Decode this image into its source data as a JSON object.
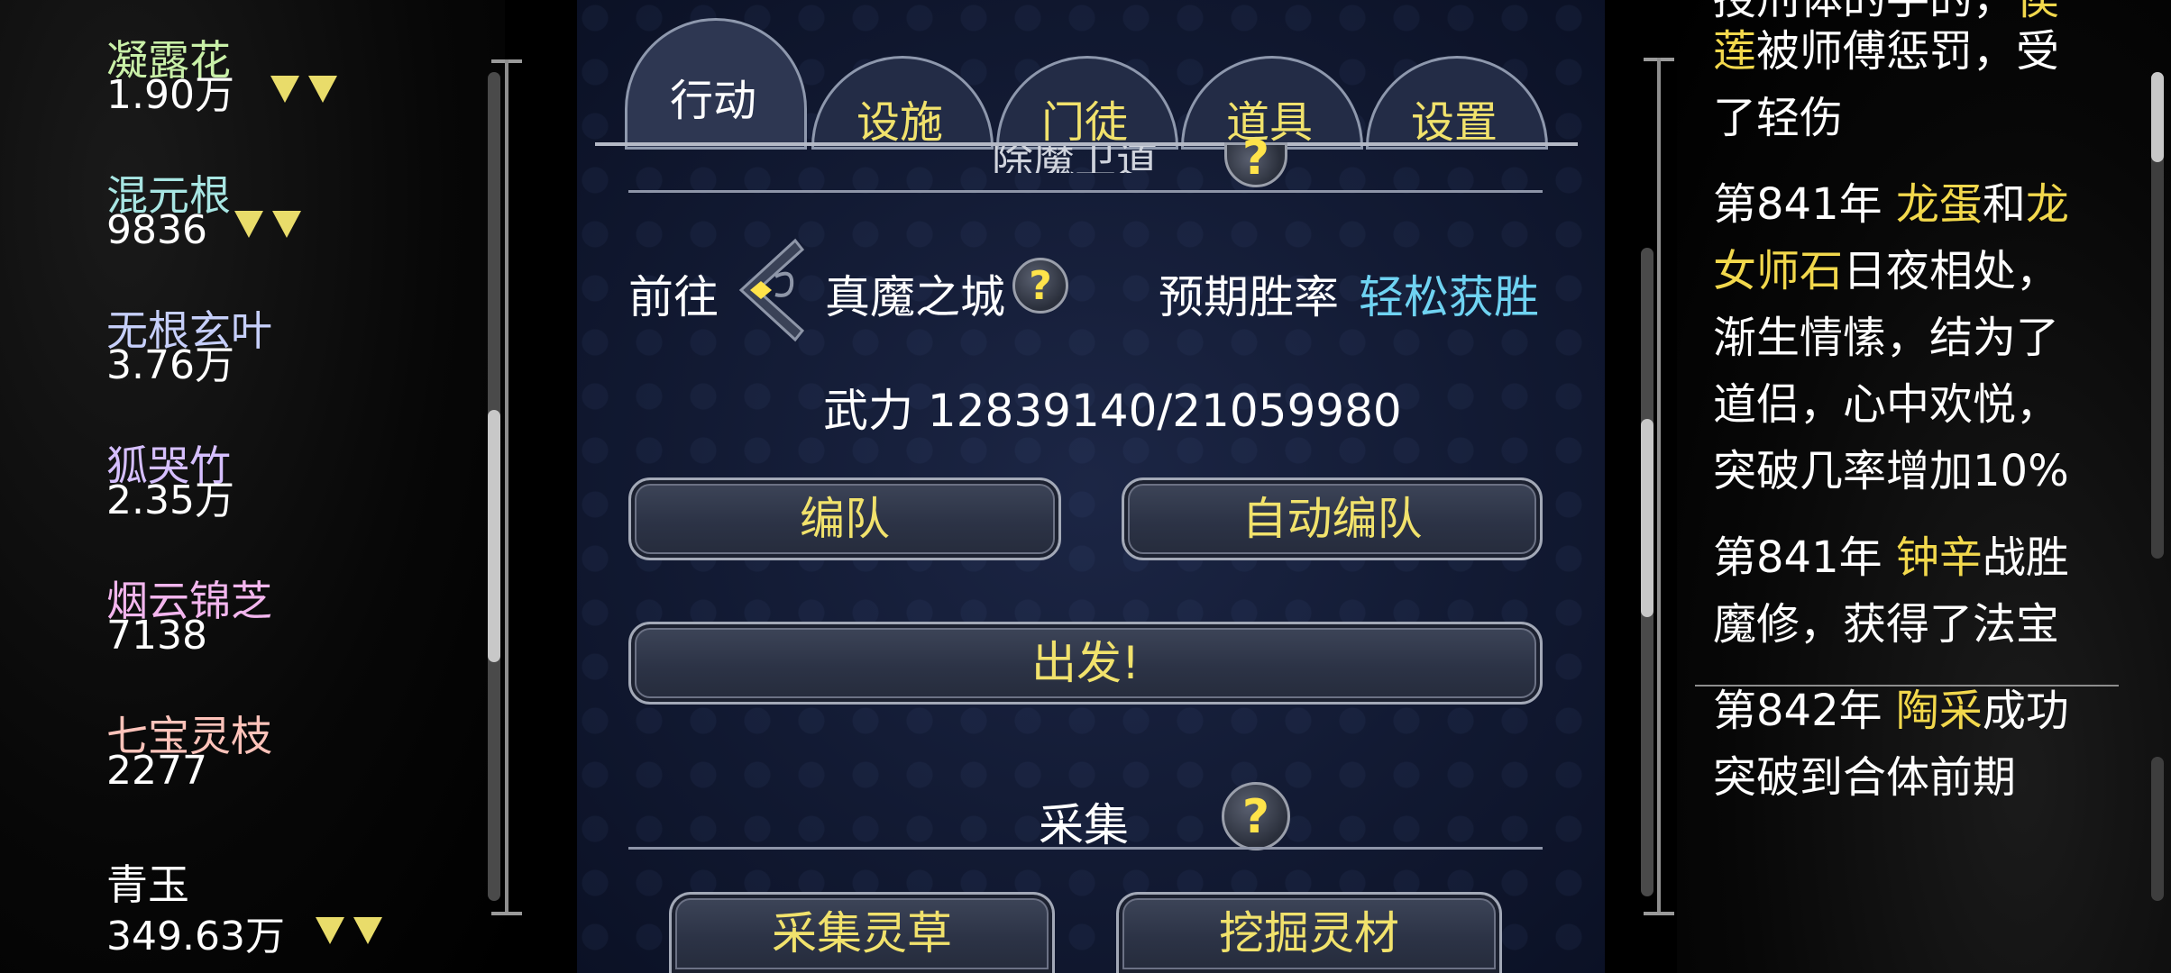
{
  "resources": [
    {
      "name": "凝露花",
      "value": "1.90万",
      "color": "#c9f0a8",
      "arrows": 2
    },
    {
      "name": "混元根",
      "value": "9836",
      "color": "#a8e6e3",
      "arrows": 2
    },
    {
      "name": "无根玄叶",
      "value": "3.76万",
      "color": "#c6cffa",
      "arrows": 0
    },
    {
      "name": "狐哭竹",
      "value": "2.35万",
      "color": "#d6bfff",
      "arrows": 0
    },
    {
      "name": "烟云锦芝",
      "value": "7138",
      "color": "#f3b6ee",
      "arrows": 0
    },
    {
      "name": "七宝灵枝",
      "value": "2277",
      "color": "#ffc3ba",
      "arrows": 0
    },
    {
      "name": "青玉",
      "value": "349.63万",
      "color": "#ffffff",
      "arrows": 2
    }
  ],
  "tabs": [
    "行动",
    "设施",
    "门徒",
    "道具",
    "设置"
  ],
  "active_tab": "行动",
  "section_partial": "除魔卫道",
  "goto_label": "前往",
  "destination": "真魔之城",
  "winrate_label": "预期胜率",
  "winrate_value": "轻松获胜",
  "winrate_color": "#6fd3f2",
  "power_text": "武力 12839140/21059980",
  "buttons": {
    "formation": "编队",
    "auto_formation": "自动编队",
    "depart": "出发!",
    "gather_herbs": "采集灵草",
    "dig_materials": "挖掘灵材"
  },
  "gather_section": "采集",
  "help_symbol": "?",
  "log": {
    "entry0": [
      {
        "t": "授刑体的手的，",
        "hl": false
      },
      {
        "t": "侯",
        "hl": true
      }
    ],
    "entry0b": [
      {
        "t": "莲",
        "hl": true
      },
      {
        "t": "被师傅惩罚，受",
        "hl": false
      }
    ],
    "entry0c": "了轻伤",
    "entry1a": [
      {
        "t": "第841年 ",
        "hl": false
      },
      {
        "t": "龙蛋",
        "hl": true
      },
      {
        "t": "和",
        "hl": false
      },
      {
        "t": "龙",
        "hl": true
      }
    ],
    "entry1b": [
      {
        "t": "女师石",
        "hl": true
      },
      {
        "t": "日夜相处，",
        "hl": false
      }
    ],
    "entry1c": "渐生情愫，结为了",
    "entry1d": "道侣，心中欢悦，",
    "entry1e": "突破几率增加10%",
    "entry2a": [
      {
        "t": "第841年 ",
        "hl": false
      },
      {
        "t": "钟辛",
        "hl": true
      },
      {
        "t": "战胜",
        "hl": false
      }
    ],
    "entry2b": "魔修，获得了法宝",
    "entry3a": [
      {
        "t": "第842年 ",
        "hl": false
      },
      {
        "t": "陶采",
        "hl": true
      },
      {
        "t": "成功",
        "hl": false
      }
    ],
    "entry3b": "突破到合体前期"
  },
  "colors": {
    "highlight": "#f2d84c",
    "button_text": "#f1e26c"
  }
}
